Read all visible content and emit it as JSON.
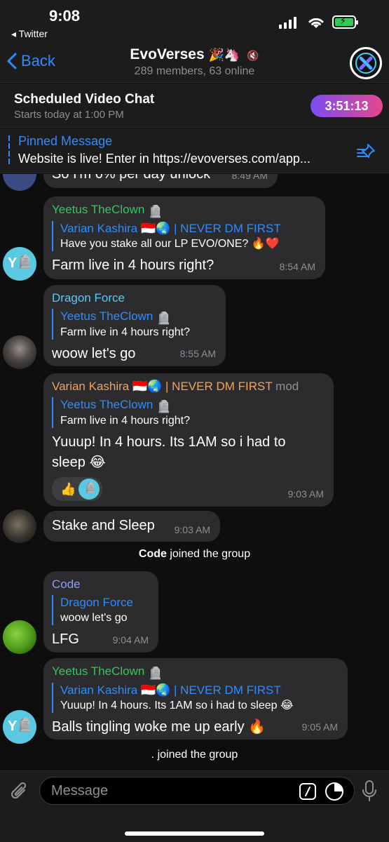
{
  "status": {
    "time": "9:08",
    "back_app": "◂ Twitter"
  },
  "header": {
    "back_label": "Back",
    "title": "EvoVerses",
    "title_emojis": "🎉🦄",
    "subtitle": "289 members, 63 online"
  },
  "video_chat": {
    "title": "Scheduled Video Chat",
    "subtitle": "Starts today at 1:00 PM",
    "timer": "3:51:13"
  },
  "pinned": {
    "title": "Pinned Message",
    "text": "Website is live!  Enter in https://evoverses.com/app..."
  },
  "top_partial": {
    "text": "So I'm 6% per day unlock",
    "time": "8:49 AM"
  },
  "messages": [
    {
      "sender": "Yeetus TheClown",
      "reply_name": "Varian Kashira 🇮🇩🌏 | NEVER DM FIRST",
      "reply_text": "Have you stake all our LP EVO/ONE? 🔥❤️",
      "text": "Farm live in 4 hours right?",
      "time": "8:54 AM"
    },
    {
      "sender": "Dragon Force",
      "reply_name": "Yeetus TheClown",
      "reply_text": "Farm live in 4 hours right?",
      "text": "woow  let's go",
      "time": "8:55 AM"
    },
    {
      "sender": "Varian Kashira 🇮🇩🌏 | NEVER DM FIRST",
      "sender_tag": "mod",
      "reply_name": "Yeetus TheClown",
      "reply_text": "Farm live in 4 hours right?",
      "text": "Yuuup! In 4 hours. Its 1AM so i had to sleep 😂",
      "reaction": "👍",
      "time": "9:03 AM"
    },
    {
      "text": "Stake and Sleep",
      "time": "9:03 AM"
    },
    {
      "sender": "Code",
      "reply_name": "Dragon Force",
      "reply_text": "woow  let's go",
      "text": "LFG",
      "time": "9:04 AM"
    },
    {
      "sender": "Yeetus TheClown",
      "reply_name": "Varian Kashira 🇮🇩🌏 | NEVER DM FIRST",
      "reply_text": "Yuuup! In 4 hours. Its 1AM so i had to sleep 😂",
      "text": "Balls tingling woke me up early 🔥",
      "time": "9:05 AM"
    }
  ],
  "service": [
    {
      "name": "Code",
      "action": " joined the group"
    },
    {
      "name": "",
      "action": ". joined the group"
    }
  ],
  "avatar_letter": "Y",
  "composer": {
    "placeholder": "Message"
  },
  "colors": {
    "accent": "#2f8cff",
    "bubble": "#2c2c2e",
    "name_yeetus": "#34c759",
    "name_dragon": "#5ac8fa",
    "name_varian": "#f0a35e",
    "name_code": "#8c9cff"
  }
}
